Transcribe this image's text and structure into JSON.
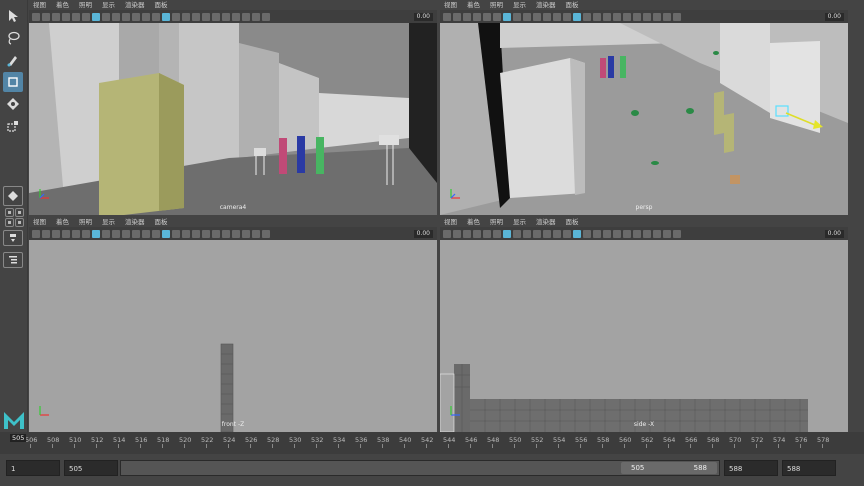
{
  "viewport_menu": [
    "视图",
    "着色",
    "照明",
    "显示",
    "渲染器",
    "面板"
  ],
  "viewports": [
    {
      "id": "top-left",
      "camera": "camera4",
      "field_value": "0.00"
    },
    {
      "id": "top-right",
      "camera": "persp",
      "field_value": "0.00"
    },
    {
      "id": "bottom-left",
      "camera": "front -Z",
      "field_value": "0.00"
    },
    {
      "id": "bottom-right",
      "camera": "side -X",
      "field_value": "0.00"
    }
  ],
  "timeline": {
    "current_frame": "505",
    "ticks": [
      "506",
      "508",
      "510",
      "512",
      "514",
      "516",
      "518",
      "520",
      "522",
      "524",
      "526",
      "528",
      "530",
      "532",
      "534",
      "536",
      "538",
      "540",
      "542",
      "544",
      "546",
      "548",
      "550",
      "552",
      "554",
      "556",
      "558",
      "560",
      "562",
      "564",
      "566",
      "568",
      "570",
      "572",
      "574",
      "576",
      "578"
    ]
  },
  "range": {
    "start_frame": "1",
    "playback_start": "505",
    "handle_start": "505",
    "handle_end": "588",
    "playback_end": "588",
    "end_frame": "588"
  },
  "icons": {
    "select": "arrow-select-icon",
    "lasso": "lasso-icon",
    "paint": "paint-select-icon",
    "move": "move-icon",
    "rotate": "rotate-icon",
    "scale": "scale-icon"
  },
  "colors": {
    "accent": "#5285a6",
    "highlight": "#5ab6d8",
    "viewport_bg": "#a3a3a3"
  }
}
